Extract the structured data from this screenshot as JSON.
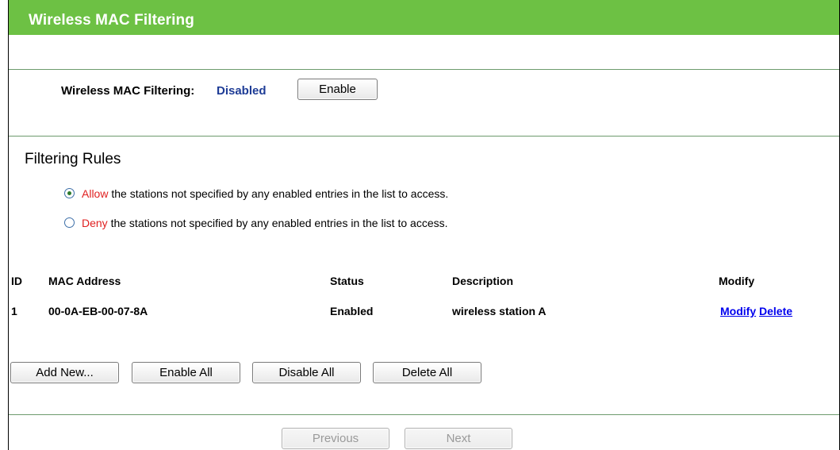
{
  "header": {
    "title": "Wireless MAC Filtering"
  },
  "status": {
    "label": "Wireless MAC Filtering:",
    "value": "Disabled",
    "toggle_label": "Enable"
  },
  "rules": {
    "title": "Filtering Rules",
    "options": [
      {
        "keyword": "Allow",
        "text": " the stations not specified by any enabled entries in the list to access.",
        "selected": true
      },
      {
        "keyword": "Deny",
        "text": " the stations not specified by any enabled entries in the list to access.",
        "selected": false
      }
    ]
  },
  "table": {
    "headers": {
      "id": "ID",
      "mac": "MAC Address",
      "status": "Status",
      "description": "Description",
      "modify": "Modify"
    },
    "rows": [
      {
        "id": "1",
        "mac": "00-0A-EB-00-07-8A",
        "status": "Enabled",
        "description": "wireless station A",
        "modify_label": "Modify",
        "delete_label": "Delete"
      }
    ]
  },
  "actions": {
    "add_new": "Add New...",
    "enable_all": "Enable All",
    "disable_all": "Disable All",
    "delete_all": "Delete All"
  },
  "nav": {
    "previous": "Previous",
    "next": "Next"
  }
}
